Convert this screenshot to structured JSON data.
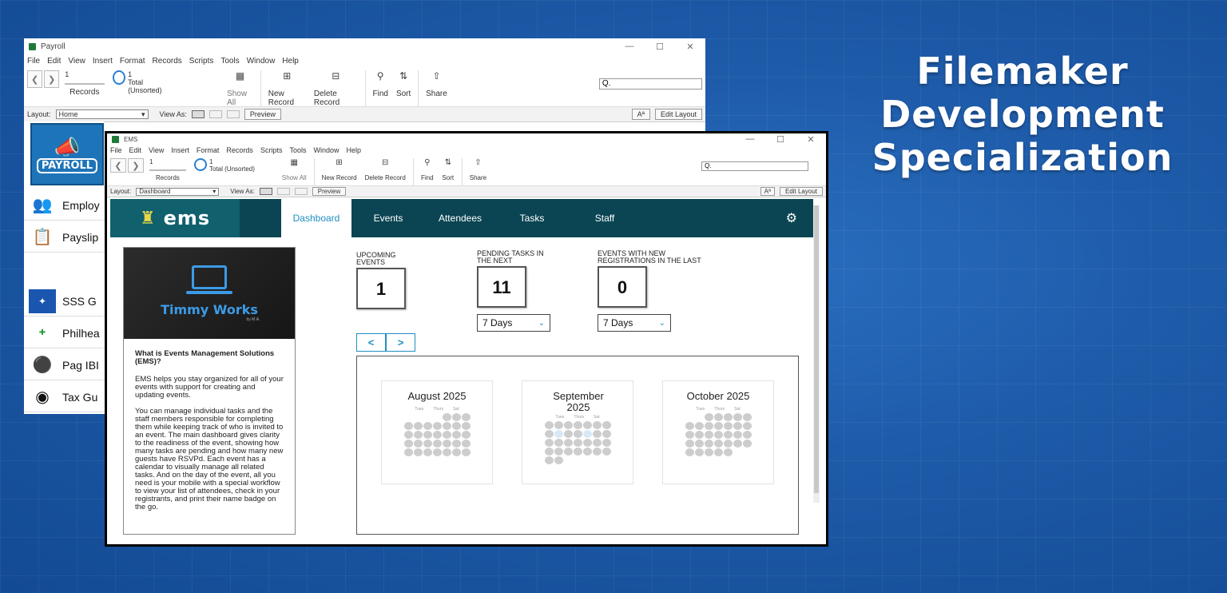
{
  "headline": {
    "line1": "Filemaker",
    "line2": "Development",
    "line3": "Specialization"
  },
  "payroll_window": {
    "title": "Payroll",
    "menu": [
      "File",
      "Edit",
      "View",
      "Insert",
      "Format",
      "Records",
      "Scripts",
      "Tools",
      "Window",
      "Help"
    ],
    "record_number": "1",
    "records_label": "Records",
    "total": "1",
    "total_label": "Total (Unsorted)",
    "toolbar": {
      "show_all": "Show All",
      "new_record": "New Record",
      "delete_record": "Delete Record",
      "find": "Find",
      "sort": "Sort",
      "share": "Share"
    },
    "search_placeholder": "Q.",
    "layout_label": "Layout:",
    "layout_value": "Home",
    "view_as": "View As:",
    "preview": "Preview",
    "aa": "Aª",
    "edit_layout": "Edit Layout",
    "logo_text": "PAYROLL",
    "side_items": [
      "Employ",
      "Payslip",
      "SSS G",
      "Philhea",
      "Pag IBI",
      "Tax Gu"
    ]
  },
  "ems_window": {
    "title": "EMS",
    "menu": [
      "File",
      "Edit",
      "View",
      "Insert",
      "Format",
      "Records",
      "Scripts",
      "Tools",
      "Window",
      "Help"
    ],
    "record_number": "1",
    "records_label": "Records",
    "total": "1",
    "total_label": "Total (Unsorted)",
    "toolbar": {
      "show_all": "Show All",
      "new_record": "New Record",
      "delete_record": "Delete Record",
      "find": "Find",
      "sort": "Sort",
      "share": "Share"
    },
    "search_placeholder": "Q.",
    "layout_label": "Layout:",
    "layout_value": "Dashboard",
    "view_as": "View As:",
    "preview": "Preview",
    "aa": "Aª",
    "edit_layout": "Edit Layout",
    "logo_text": "ems",
    "nav_tabs": [
      "Dashboard",
      "Events",
      "Attendees",
      "Tasks",
      "Staff"
    ],
    "active_tab": "Dashboard",
    "info_card": {
      "brand": "Timmy Works",
      "brand_sub": "by M.A.",
      "heading": "What is Events Management Solutions (EMS)?",
      "para1": "EMS helps you stay organized for all of your events with support for creating and updating events.",
      "para2": "You can manage individual tasks and the staff members responsible for completing them while keeping track of who is invited to an event. The main dashboard gives clarity to the readiness of the event, showing how many tasks are pending and how many new guests have RSVPd. Each event has a calendar to visually manage all related tasks. And on the day of the event, all you need is your mobile with a special workflow to view your list of attendees, check in your registrants, and print their name badge on the go."
    },
    "stats": [
      {
        "label": "UPCOMING EVENTS",
        "value": "1"
      },
      {
        "label": "PENDING TASKS IN THE NEXT",
        "value": "11",
        "range": "7 Days"
      },
      {
        "label": "EVENTS WITH NEW REGISTRATIONS IN THE LAST",
        "value": "0",
        "range": "7 Days"
      }
    ],
    "pager": {
      "prev": "<",
      "next": ">"
    },
    "calendars": [
      {
        "month": "August 2025",
        "weekdays": [
          "Tues",
          "Thurs",
          "Sat"
        ]
      },
      {
        "month": "September 2025",
        "weekdays": [
          "Tues",
          "Thurs",
          "Sat"
        ]
      },
      {
        "month": "October 2025",
        "weekdays": [
          "Tues",
          "Thurs",
          "Sat"
        ]
      }
    ]
  }
}
